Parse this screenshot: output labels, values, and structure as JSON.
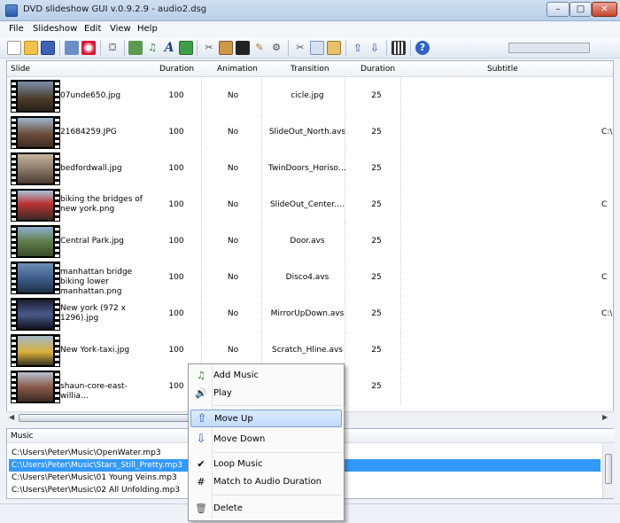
{
  "window": {
    "title": "DVD slideshow GUI v.0.9.2.9 - audio2.dsg",
    "min": "–",
    "max": "□",
    "close": "✕"
  },
  "menu": [
    "File",
    "Slideshow",
    "Edit",
    "View",
    "Help"
  ],
  "table": {
    "headers": {
      "slide": "Slide",
      "duration": "Duration",
      "animation": "Animation",
      "transition": "Transition",
      "tduration": "Duration",
      "subtitle": "Subtitle"
    },
    "rows": [
      {
        "name": "07unde650.jpg",
        "duration": "100",
        "animation": "No",
        "transition": "cicle.jpg",
        "tduration": "25",
        "edge": ""
      },
      {
        "name": "21684259.JPG",
        "duration": "100",
        "animation": "No",
        "transition": "SlideOut_North.avs",
        "tduration": "25",
        "edge": "C:\\"
      },
      {
        "name": "bedfordwall.jpg",
        "duration": "100",
        "animation": "No",
        "transition": "TwinDoors_Horiso…",
        "tduration": "25",
        "edge": ""
      },
      {
        "name": "biking the bridges of new york.png",
        "duration": "100",
        "animation": "No",
        "transition": "SlideOut_Center.…",
        "tduration": "25",
        "edge": "C"
      },
      {
        "name": "Central Park.jpg",
        "duration": "100",
        "animation": "No",
        "transition": "Door.avs",
        "tduration": "25",
        "edge": ""
      },
      {
        "name": "manhattan bridge biking lower manhattan.png",
        "duration": "100",
        "animation": "No",
        "transition": "Disco4.avs",
        "tduration": "25",
        "edge": "C"
      },
      {
        "name": "New york (972 x 1296).jpg",
        "duration": "100",
        "animation": "No",
        "transition": "MirrorUpDown.avs",
        "tduration": "25",
        "edge": "C:\\"
      },
      {
        "name": "New York-taxi.jpg",
        "duration": "100",
        "animation": "No",
        "transition": "Scratch_Hline.avs",
        "tduration": "25",
        "edge": ""
      },
      {
        "name": "shaun-core-east-willia…",
        "duration": "100",
        "animation": "",
        "transition": "",
        "tduration": "25",
        "edge": ""
      }
    ]
  },
  "music": {
    "header": "Music",
    "rows": [
      {
        "path": "C:\\Users\\Peter\\Music\\OpenWater.mp3",
        "selected": false
      },
      {
        "path": "C:\\Users\\Peter\\Music\\Stars_Still_Pretty.mp3",
        "selected": true
      },
      {
        "path": "C:\\Users\\Peter\\Music\\01 Young Veins.mp3",
        "selected": false
      },
      {
        "path": "C:\\Users\\Peter\\Music\\02 All Unfolding.mp3",
        "selected": false
      }
    ]
  },
  "context_menu": {
    "add_music": "Add Music",
    "play": "Play",
    "move_up": "Move Up",
    "move_down": "Move Down",
    "loop_music": "Loop Music",
    "match_duration": "Match to Audio Duration",
    "delete": "Delete",
    "highlighted": "move_up"
  },
  "colors": {
    "selection": "#3399ff",
    "menu_highlight": "#c1dbfc"
  }
}
